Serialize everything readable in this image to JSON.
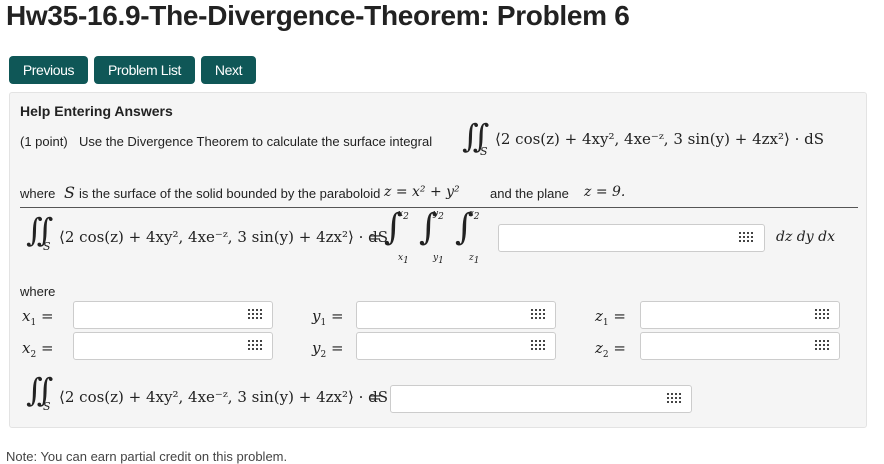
{
  "page": {
    "title": "Hw35-16.9-The-Divergence-Theorem: Problem 6"
  },
  "nav": {
    "previous": "Previous",
    "problem_list": "Problem List",
    "next": "Next"
  },
  "problem": {
    "help_link": "Help Entering Answers",
    "points": "(1 point)",
    "statement": "Use the Divergence Theorem to calculate the surface integral",
    "field": "⟨2 cos(z) + 4xy², 4xe⁻ᶻ, 3 sin(y) + 4zx²⟩ · dS",
    "where_text_1": "where",
    "where_text_2": "is the surface of the solid bounded by the paraboloid",
    "paraboloid": "z = x² + y²",
    "and_the_plane": "and the plane",
    "plane": "z = 9.",
    "surface_var": "S",
    "differentials": "dz dy dx",
    "where_label": "where"
  },
  "inputs": {
    "integrand": {
      "value": ""
    },
    "x1": {
      "label": "x",
      "sub": "1",
      "value": ""
    },
    "x2": {
      "label": "x",
      "sub": "2",
      "value": ""
    },
    "y1": {
      "label": "y",
      "sub": "1",
      "value": ""
    },
    "y2": {
      "label": "y",
      "sub": "2",
      "value": ""
    },
    "z1": {
      "label": "z",
      "sub": "1",
      "value": ""
    },
    "z2": {
      "label": "z",
      "sub": "2",
      "value": ""
    },
    "final": {
      "value": ""
    }
  },
  "footer": {
    "note": "Note: You can earn partial credit on this problem."
  },
  "icons": {
    "keyboard": "equation-editor-icon",
    "surface_integral": "double-integral-icon"
  }
}
